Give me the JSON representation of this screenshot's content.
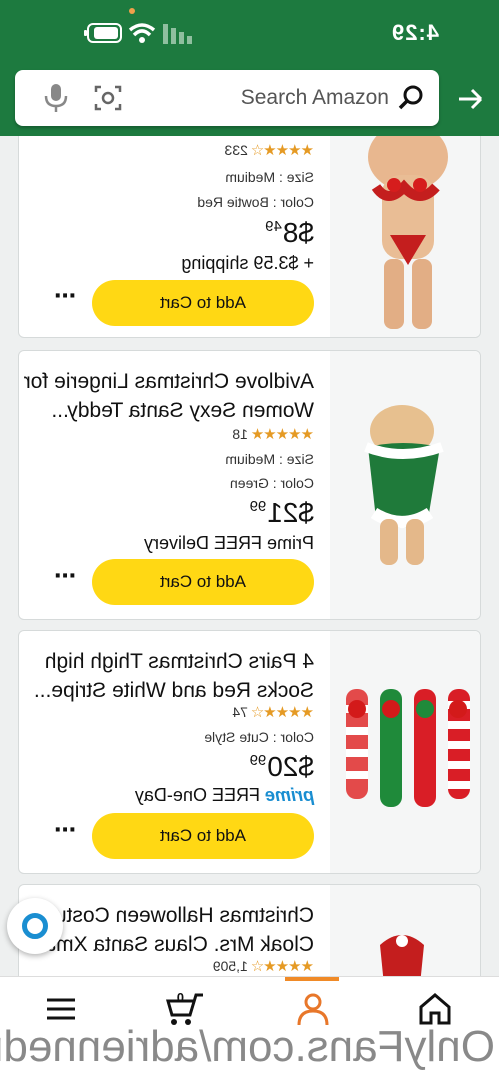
{
  "status_bar": {
    "time": "4:29"
  },
  "search": {
    "placeholder": "Search Amazon"
  },
  "products": [
    {
      "title_lines": [],
      "rating_count": "233",
      "meta": [
        "Size : Medium",
        "Color : Bowtie Red"
      ],
      "price_main": "$8",
      "price_cents": "49",
      "shipping": "+ $3.59 shipping",
      "add_label": "Add to Cart"
    },
    {
      "title_lines": [
        "Avidlove Christmas Lingerie for",
        "Women Sexy Santa Teddy..."
      ],
      "rating_count": "18",
      "meta": [
        "Size : Medium",
        "Color : Green"
      ],
      "price_main": "$21",
      "price_cents": "99",
      "shipping": "Prime FREE Delivery",
      "add_label": "Add to Cart"
    },
    {
      "title_lines": [
        "4 Pairs Christmas Thigh high",
        "Socks Red and White Stripe..."
      ],
      "rating_count": "74",
      "meta": [
        "Color : Cute Style"
      ],
      "price_main": "$20",
      "price_cents": "99",
      "shipping_prime": "prime",
      "shipping": "FREE One-Day",
      "add_label": "Add to Cart"
    },
    {
      "title_lines": [
        "Christmas Halloween Costum",
        "Cloak Mrs. Claus Santa Xmas..."
      ],
      "rating_count": "1,509"
    }
  ],
  "watermark": "OnlyFans.com/adriennedr",
  "colors": {
    "header": "#1d7a3f",
    "button": "#ffd814",
    "accent": "#f08a27",
    "star": "#e59a24"
  }
}
